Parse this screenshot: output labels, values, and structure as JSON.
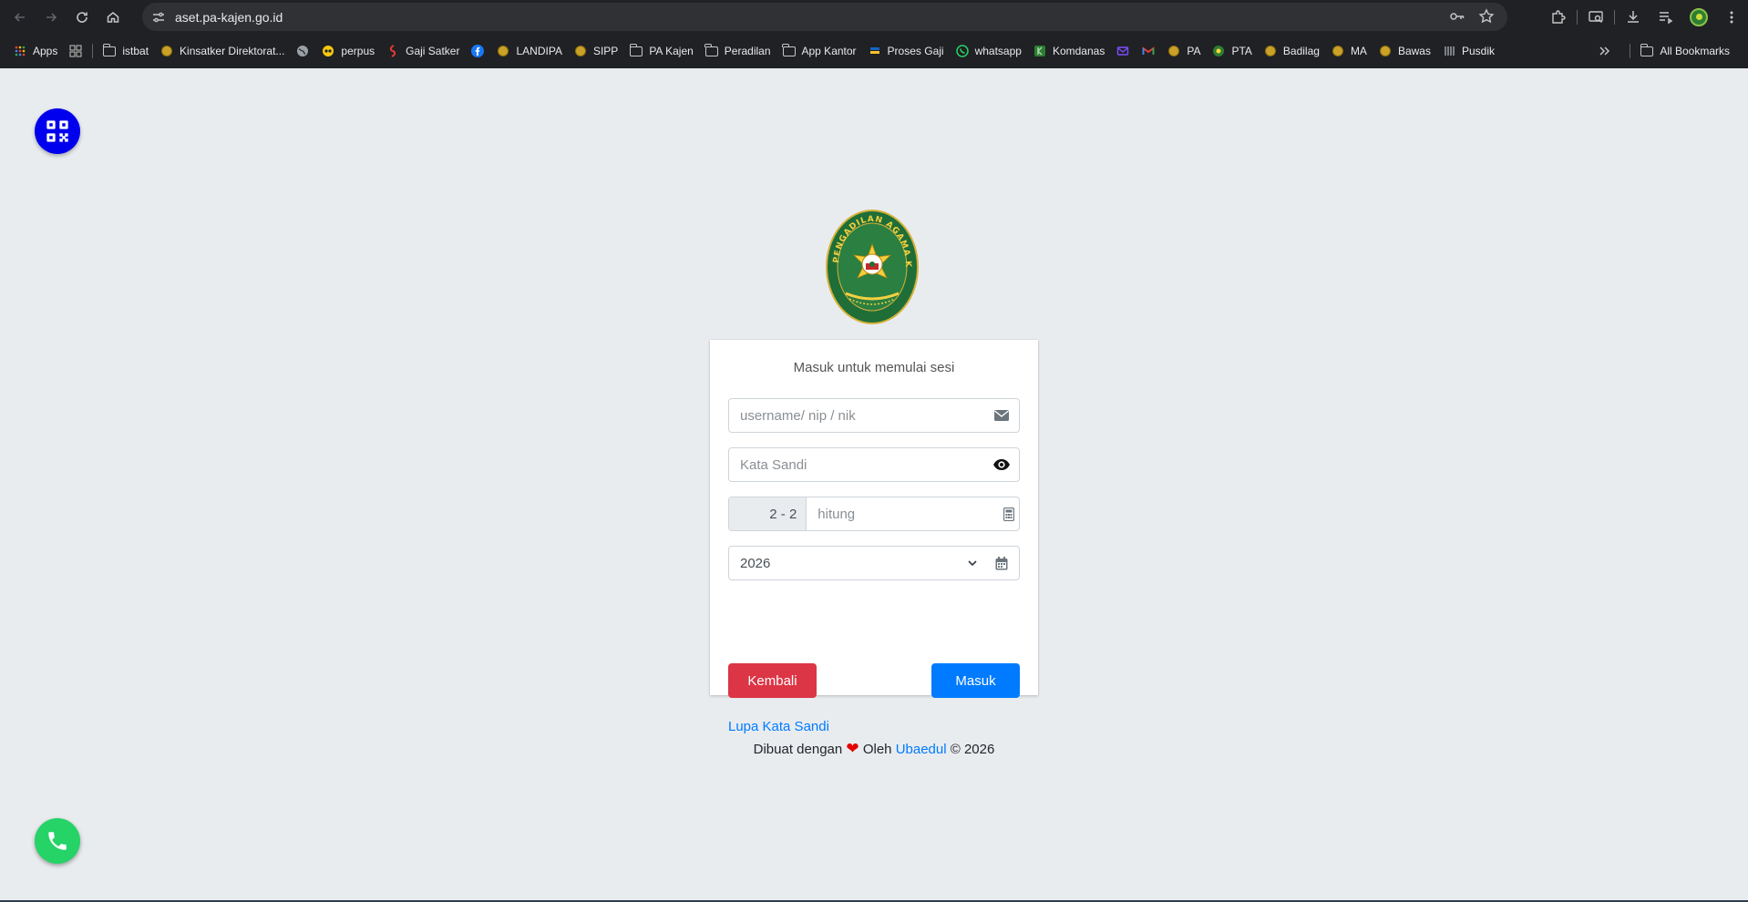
{
  "browser": {
    "url": "aset.pa-kajen.go.id",
    "bookmarks": [
      {
        "label": "Apps",
        "icon": "apps-grid-icon"
      },
      {
        "label": "",
        "icon": "grid-icon"
      },
      {
        "label": "istbat",
        "icon": "folder-icon"
      },
      {
        "label": "Kinsatker Direktorat...",
        "icon": "coin-icon"
      },
      {
        "label": "",
        "icon": "globe-icon"
      },
      {
        "label": "perpus",
        "icon": "perpus-icon"
      },
      {
        "label": "Gaji Satker",
        "icon": "gaji-icon"
      },
      {
        "label": "",
        "icon": "facebook-icon"
      },
      {
        "label": "LANDIPA",
        "icon": "coin-icon"
      },
      {
        "label": "SIPP",
        "icon": "coin-icon"
      },
      {
        "label": "PA Kajen",
        "icon": "folder-icon"
      },
      {
        "label": "Peradilan",
        "icon": "folder-icon"
      },
      {
        "label": "App Kantor",
        "icon": "folder-icon"
      },
      {
        "label": "Proses Gaji",
        "icon": "proses-gaji-icon"
      },
      {
        "label": "whatsapp",
        "icon": "whatsapp-icon"
      },
      {
        "label": "Komdanas",
        "icon": "komdanas-icon"
      },
      {
        "label": "",
        "icon": "mail-icon"
      },
      {
        "label": "",
        "icon": "gmail-icon"
      },
      {
        "label": "PA",
        "icon": "coin-icon"
      },
      {
        "label": "PTA",
        "icon": "pta-icon"
      },
      {
        "label": "Badilag",
        "icon": "coin-icon"
      },
      {
        "label": "MA",
        "icon": "coin-icon"
      },
      {
        "label": "Bawas",
        "icon": "coin-icon"
      },
      {
        "label": "Pusdik",
        "icon": "pusdik-icon"
      }
    ],
    "all_bookmarks": "All Bookmarks"
  },
  "login": {
    "session_message": "Masuk untuk memulai sesi",
    "username_placeholder": "username/ nip / nik",
    "password_placeholder": "Kata Sandi",
    "captcha_question": "2 - 2",
    "captcha_placeholder": "hitung",
    "year_selected": "2026",
    "back_label": "Kembali",
    "login_label": "Masuk",
    "forgot_label": "Lupa Kata Sandi"
  },
  "logo_text": "PENGADILAN AGAMA KAJEN",
  "footer": {
    "made_with": "Dibuat dengan",
    "by": "Oleh",
    "author": "Ubaedul",
    "copyright": "© 2026"
  },
  "colors": {
    "danger": "#dc3545",
    "primary": "#007bff",
    "qr_fab": "#0000ee",
    "whatsapp_fab": "#25d366",
    "page_bg": "#e9ecef"
  }
}
